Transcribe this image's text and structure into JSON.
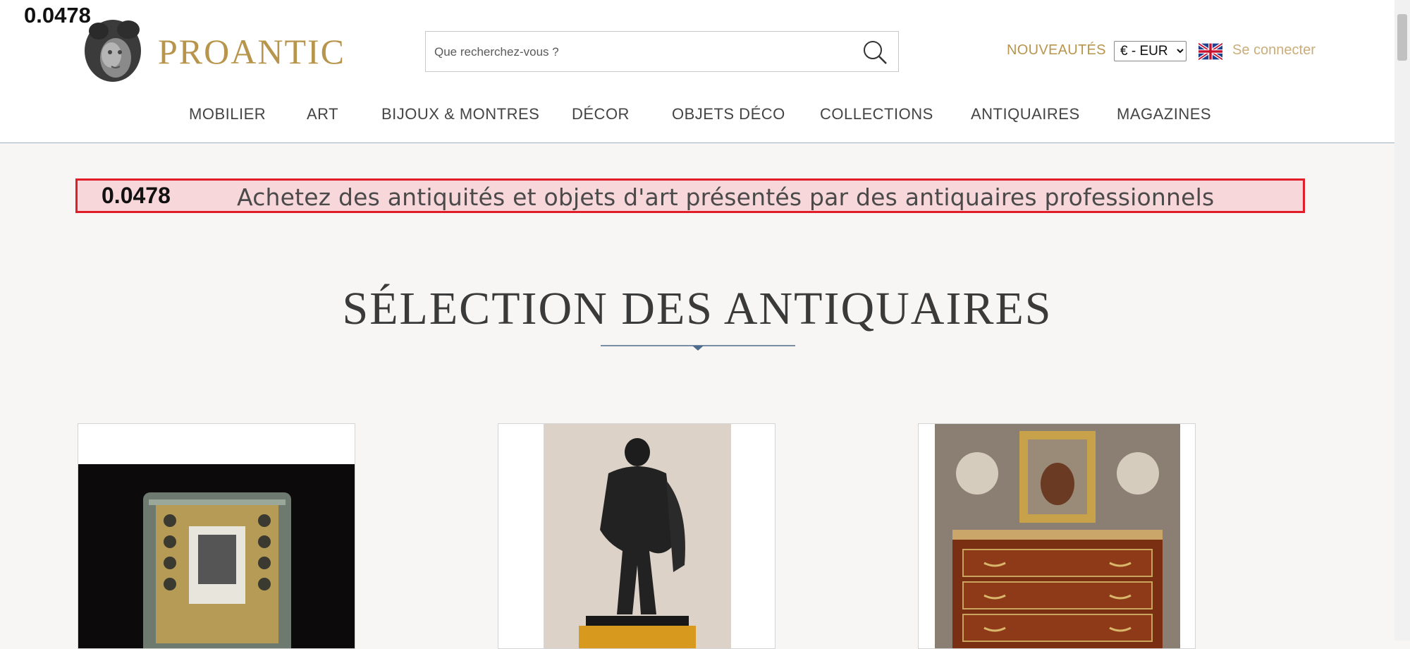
{
  "debug": {
    "score_top": "0.0478",
    "score_banner": "0.0478"
  },
  "header": {
    "brand": "PROANTIC",
    "search": {
      "placeholder": "Que recherchez-vous ?"
    },
    "nouveautes": "NOUVEAUTÉS",
    "currency": {
      "selected": "€ - EUR"
    },
    "login": "Se connecter"
  },
  "nav": {
    "items": [
      {
        "label": "MOBILIER"
      },
      {
        "label": "ART"
      },
      {
        "label": "BIJOUX & MONTRES"
      },
      {
        "label": "DÉCOR"
      },
      {
        "label": "OBJETS DÉCO"
      },
      {
        "label": "COLLECTIONS"
      },
      {
        "label": "ANTIQUAIRES"
      },
      {
        "label": "MAGAZINES"
      }
    ]
  },
  "banner": {
    "text": "Achetez des antiquités et objets d'art présentés par des antiquaires professionnels"
  },
  "section": {
    "title": "SÉLECTION DES ANTIQUAIRES"
  },
  "colors": {
    "gold": "#b8954d",
    "banner_bg": "#f8d7da",
    "banner_border": "#e11d2a",
    "divider": "#4d6b8a"
  }
}
